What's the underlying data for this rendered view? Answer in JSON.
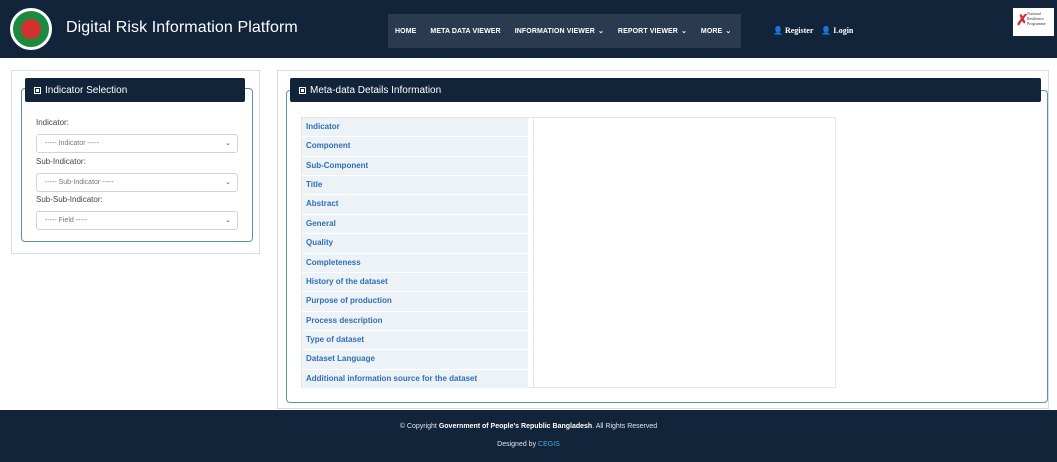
{
  "header": {
    "brand": "Digital Risk Information Platform",
    "nav": [
      {
        "label": "HOME",
        "caret": false
      },
      {
        "label": "META DATA VIEWER",
        "caret": false
      },
      {
        "label": "INFORMATION VIEWER",
        "caret": true
      },
      {
        "label": "REPORT VIEWER",
        "caret": true
      },
      {
        "label": "MORE",
        "caret": true
      }
    ],
    "register": "Register",
    "login": "Login",
    "partner_logo_text": "National Resilience Programme"
  },
  "indicator_panel": {
    "title": "Indicator Selection",
    "indicator_label": "Indicator:",
    "indicator_placeholder": "----- Indicator -----",
    "sub_indicator_label": "Sub-Indicator:",
    "sub_indicator_placeholder": "----- Sub-Indicator -----",
    "sub_sub_indicator_label": "Sub-Sub-Indicator:",
    "field_placeholder": "----- Field -----"
  },
  "metadata_panel": {
    "title": "Meta-data Details Information",
    "rows": [
      "Indicator",
      "Component",
      "Sub-Component",
      "Title",
      "Abstract",
      "General",
      "Quality",
      "Completeness",
      "History of the dataset",
      "Purpose of production",
      "Process description",
      "Type of dataset",
      "Dataset Language",
      "Additional information source for the dataset"
    ]
  },
  "footer": {
    "copyright_prefix": "© Copyright",
    "copyright_owner": "Government of People's Republic Bangladesh",
    "copyright_suffix": ". All Rights Reserved",
    "designed_by": "Designed by",
    "designer": "CEGIS"
  },
  "colors": {
    "header_bg": "#12243a",
    "nav_bg": "#2a3b4f",
    "accent_link": "#2f6fb6",
    "row_bg": "#edf2f7"
  }
}
